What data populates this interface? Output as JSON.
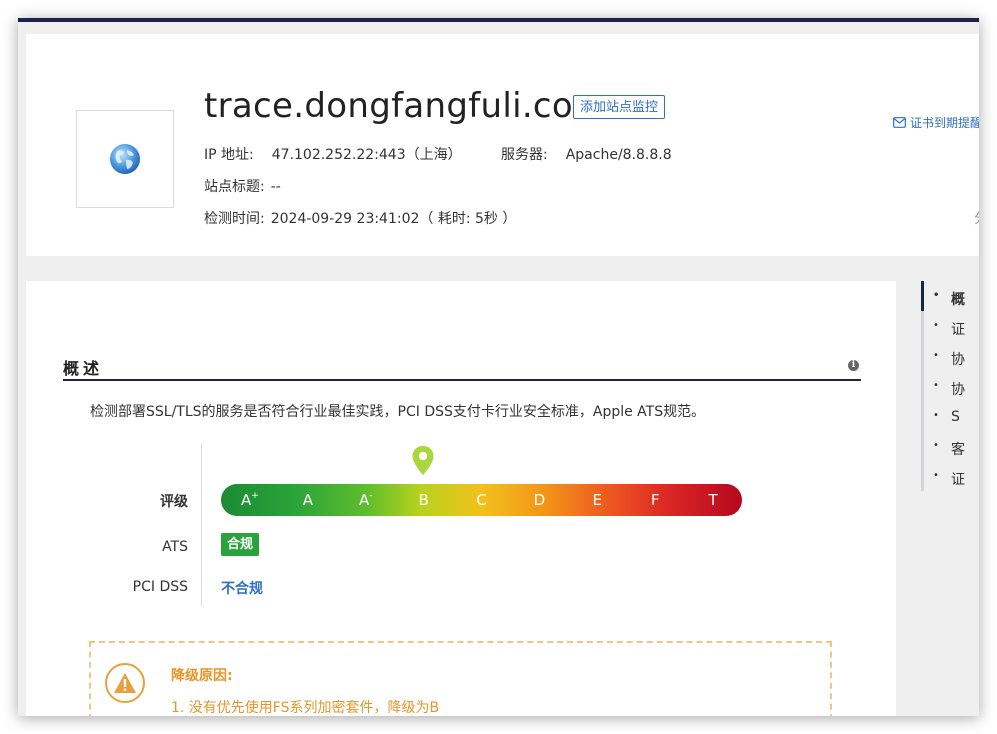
{
  "site": {
    "domain": "trace.dongfangfuli.com",
    "add_monitor_label": "添加站点监控",
    "ip_label": "IP 地址:",
    "ip_value": "47.102.252.22:443（上海）",
    "server_label": "服务器:",
    "server_value": "Apache/8.8.8.8",
    "title_label": "站点标题:",
    "title_value": "--",
    "time_label": "检测时间:",
    "time_value": "2024-09-29 23:41:02（ 耗时: 5秒 ）",
    "cert_remind_label": "证书到期提醒",
    "share_frag": "分"
  },
  "summary": {
    "section_title": "概述",
    "info_icon": "i",
    "description": "检测部署SSL/TLS的服务是否符合行业最佳实践，PCI DSS支付卡行业安全标准，Apple ATS规范。",
    "grade_label": "评级",
    "grades": [
      "A",
      "A",
      "A",
      "B",
      "C",
      "D",
      "E",
      "F",
      "T"
    ],
    "grade_suffixes": [
      "+",
      "",
      "-",
      "",
      "",
      "",
      "",
      "",
      ""
    ],
    "current_grade": "B",
    "ats_label": "ATS",
    "ats_value": "合规",
    "ats_color": "#2aa33a",
    "pci_label": "PCI DSS",
    "pci_value": "不合规",
    "downgrade_title": "降级原因:",
    "downgrade_items": [
      "1. 没有优先使用FS系列加密套件，降级为B"
    ]
  },
  "side_nav": {
    "items": [
      "概",
      "证",
      "协",
      "协",
      "S",
      "客",
      "证"
    ]
  },
  "colors": {
    "accent": "#1e2148",
    "link": "#2f6fc5",
    "warning": "#e8952a"
  }
}
